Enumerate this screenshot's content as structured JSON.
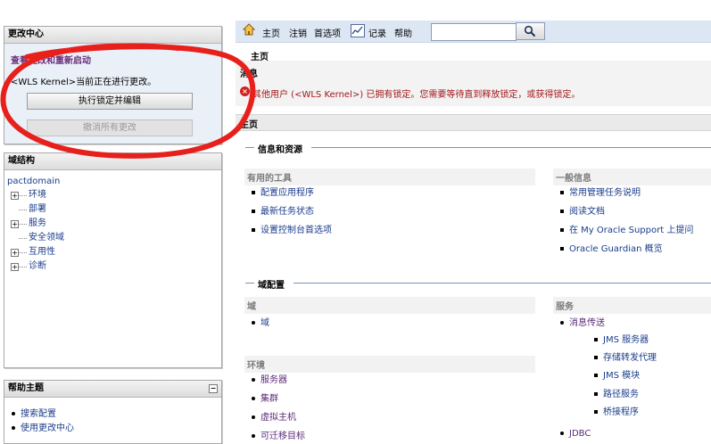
{
  "change_center": {
    "title": "更改中心",
    "view_changes_link": "查看更改和重新启动",
    "lock_message": "<WLS Kernel>当前正在进行更改。",
    "lock_edit_button": "执行锁定并编辑",
    "undo_all_button": "撤消所有更改"
  },
  "domain_structure": {
    "title": "域结构",
    "root": "pactdomain",
    "items": [
      {
        "label": "环境",
        "expandable": true
      },
      {
        "label": "部署",
        "expandable": false
      },
      {
        "label": "服务",
        "expandable": true
      },
      {
        "label": "安全领域",
        "expandable": false
      },
      {
        "label": "互用性",
        "expandable": true
      },
      {
        "label": "诊断",
        "expandable": true
      }
    ]
  },
  "help_topics": {
    "title": "帮助主题",
    "items": [
      "搜索配置",
      "使用更改中心"
    ]
  },
  "toolbar": {
    "home": "主页",
    "logout": "注销",
    "preferences": "首选项",
    "record": "记录",
    "help": "帮助",
    "search_value": ""
  },
  "breadcrumb": "主页",
  "messages": {
    "label": "消息",
    "error": "其他用户 (<WLS Kernel>) 已拥有锁定。您需要等待直到释放锁定，或获得锁定。"
  },
  "page_title": "主页",
  "info_resources": {
    "heading": "信息和资源",
    "useful_tools": {
      "heading": "有用的工具",
      "items": [
        "配置应用程序",
        "最新任务状态",
        "设置控制台首选项"
      ]
    },
    "general_info": {
      "heading": "一般信息",
      "items": [
        "常用管理任务说明",
        "阅读文档",
        "在 My Oracle Support 上提问",
        "Oracle Guardian 概览"
      ]
    }
  },
  "domain_config": {
    "heading": "域配置",
    "domain": {
      "heading": "域",
      "items": [
        "域"
      ]
    },
    "environment": {
      "heading": "环境",
      "items": [
        "服务器",
        "集群",
        "虚拟主机",
        "可迁移目标"
      ]
    },
    "services": {
      "heading": "服务",
      "messaging": "消息传送",
      "messaging_items": [
        "JMS 服务器",
        "存储转发代理",
        "JMS 模块",
        "路径服务",
        "桥接程序"
      ],
      "jdbc": "JDBC"
    }
  },
  "colors": {
    "accent": "#1a3c8c",
    "error": "#a3171a",
    "annotation": "#e8201c"
  }
}
